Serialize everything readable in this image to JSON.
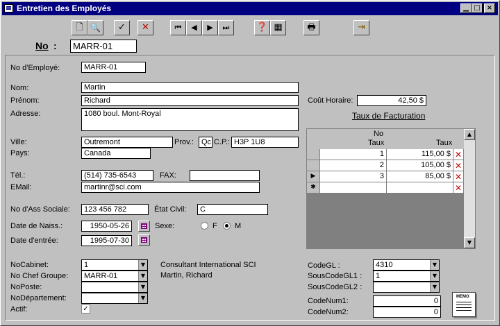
{
  "window": {
    "title": "Entretien des Employés"
  },
  "toolbar": {
    "icons": [
      "new-record-icon",
      "find-icon",
      "save-icon",
      "delete-icon",
      "first-record-icon",
      "previous-record-icon",
      "next-record-icon",
      "last-record-icon",
      "report-icon",
      "table-icon",
      "print-icon",
      "exit-icon"
    ]
  },
  "header": {
    "no_label": "No",
    "no_colon": ":",
    "no_value": "MARR-01"
  },
  "employee": {
    "no_label": "No d'Employé:",
    "no_value": "MARR-01",
    "nom_label": "Nom:",
    "nom_value": "Martin",
    "prenom_label": "Prénom:",
    "prenom_value": "Richard",
    "adresse_label": "Adresse:",
    "adresse_value": "1080 boul. Mont-Royal",
    "ville_label": "Ville:",
    "ville_value": "Outremont",
    "prov_label": "Prov.:",
    "prov_value": "Qc",
    "cp_label": "C.P.:",
    "cp_value": "H3P 1U8",
    "pays_label": "Pays:",
    "pays_value": "Canada",
    "tel_label": "Tél.:",
    "tel_value": "(514) 735-6543",
    "fax_label": "FAX:",
    "fax_value": "",
    "email_label": "EMail:",
    "email_value": "martinr@sci.com",
    "nas_label": "No d'Ass Sociale:",
    "nas_value": "123 456 782",
    "etat_label": "État Civil:",
    "etat_value": "C",
    "naiss_label": "Date de Naiss.:",
    "naiss_value": "1950-05-26",
    "sexe_label": "Sexe:",
    "sexe_f": "F",
    "sexe_m": "M",
    "sexe_selected": "M",
    "entree_label": "Date d'entrée:",
    "entree_value": "1995-07-30"
  },
  "rate": {
    "cout_label": "Coût Horaire:",
    "cout_value": "42,50 $",
    "taux_title": "Taux de Facturation",
    "col_no": "No\nTaux",
    "col_no_line1": "No",
    "col_no_line2": "Taux",
    "col_taux": "Taux",
    "rows": [
      {
        "no": "1",
        "taux": "115,00 $"
      },
      {
        "no": "2",
        "taux": "105,00 $"
      },
      {
        "no": "3",
        "taux": "85,00 $"
      }
    ],
    "current_row": 3
  },
  "bottom": {
    "cabinet_label": "NoCabinet:",
    "cabinet_value": "1",
    "chef_label": "No Chef Groupe:",
    "chef_value": "MARR-01",
    "poste_label": "NoPoste:",
    "poste_value": "",
    "dept_label": "NoDépartement:",
    "dept_value": "",
    "actif_label": "Actif:",
    "actif_checked": true,
    "info_line1": "Consultant International SCI",
    "info_line2": "Martin, Richard",
    "codegl_label": "CodeGL :",
    "codegl_value": "4310",
    "sous1_label": "SousCodeGL1 :",
    "sous1_value": "1",
    "sous2_label": "SousCodeGL2 :",
    "sous2_value": "",
    "num1_label": "CodeNum1:",
    "num1_value": "0",
    "num2_label": "CodeNum2:",
    "num2_value": "0",
    "memo_label": "MEMO"
  }
}
